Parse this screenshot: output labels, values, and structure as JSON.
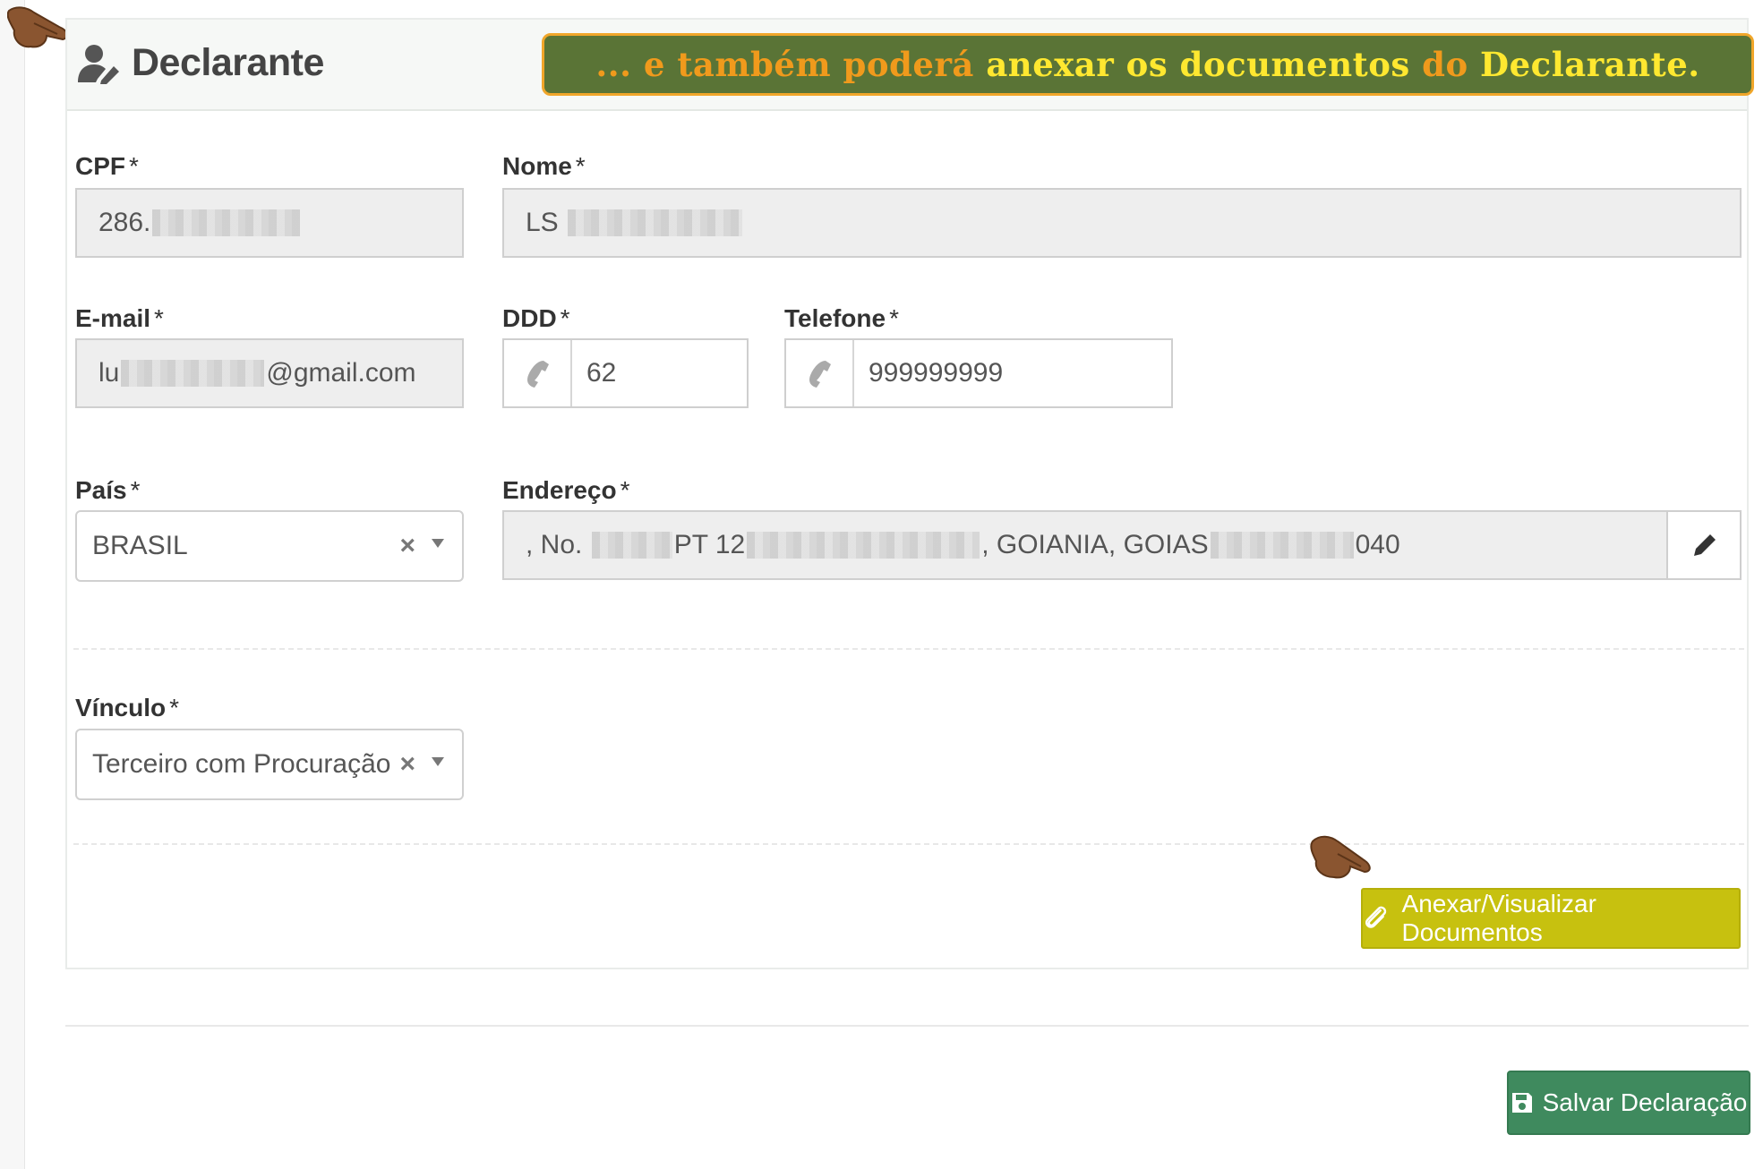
{
  "panel": {
    "title": "Declarante",
    "callout": {
      "part1": "... e também poderá",
      "part2": "anexar os documentos",
      "part3": "do",
      "part4": "Declarante."
    }
  },
  "fields": {
    "cpf": {
      "label": "CPF",
      "required": "*",
      "value": "286."
    },
    "nome": {
      "label": "Nome",
      "required": "*",
      "value": "LS"
    },
    "email": {
      "label": "E-mail",
      "required": "*",
      "value_prefix": "lu",
      "value_suffix": "@gmail.com"
    },
    "ddd": {
      "label": "DDD",
      "required": "*",
      "value": "62"
    },
    "telefone": {
      "label": "Telefone",
      "required": "*",
      "value": "999999999"
    },
    "pais": {
      "label": "País",
      "required": "*",
      "value": "BRASIL",
      "clear": "×"
    },
    "endereco": {
      "label": "Endereço",
      "required": "*",
      "part1": ", No.",
      "part2": "PT 12",
      "part3": ", GOIANIA, GOIAS",
      "part4": "040"
    },
    "vinculo": {
      "label": "Vínculo",
      "required": "*",
      "value": "Terceiro com Procuração",
      "clear": "×"
    }
  },
  "buttons": {
    "attach": "Anexar/Visualizar Documentos",
    "save": "Salvar Declaração"
  },
  "colors": {
    "callout_bg": "#5a7436",
    "callout_orange": "#f09a1c",
    "callout_yellow": "#ffe830",
    "attach_bg": "#c7c10f",
    "save_bg": "#3f8a5e"
  },
  "icons": {
    "title": "user-edit-icon",
    "phone": "phone-icon",
    "edit": "pencil-icon",
    "attach": "paperclip-icon",
    "save": "floppy-disk-icon",
    "pointer": "pointing-hand-icon"
  }
}
